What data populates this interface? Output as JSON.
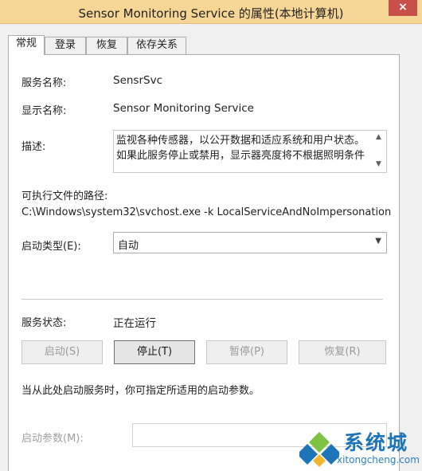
{
  "window": {
    "title": "Sensor Monitoring Service 的属性(本地计算机)",
    "close_label": "×"
  },
  "tabs": [
    {
      "label": "常规",
      "active": true
    },
    {
      "label": "登录",
      "active": false
    },
    {
      "label": "恢复",
      "active": false
    },
    {
      "label": "依存关系",
      "active": false
    }
  ],
  "general": {
    "service_name_label": "服务名称:",
    "service_name_value": "SensrSvc",
    "display_name_label": "显示名称:",
    "display_name_value": "Sensor Monitoring Service",
    "description_label": "描述:",
    "description_lines": [
      "监视各种传感器，以公开数据和适应系统和用户状态。",
      "如果此服务停止或禁用，显示器亮度将不根据照明条件"
    ],
    "path_label": "可执行文件的路径:",
    "path_value": "C:\\Windows\\system32\\svchost.exe -k LocalServiceAndNoImpersonation",
    "startup_type_label": "启动类型(E):",
    "startup_type_value": "自动",
    "status_label": "服务状态:",
    "status_value": "正在运行",
    "hint_text": "当从此处启动服务时，你可指定所适用的启动参数。",
    "param_label": "启动参数(M):",
    "param_value": ""
  },
  "buttons": {
    "start": {
      "label": "启动(S)",
      "enabled": false
    },
    "stop": {
      "label": "停止(T)",
      "enabled": true
    },
    "pause": {
      "label": "暂停(P)",
      "enabled": false
    },
    "resume": {
      "label": "恢复(R)",
      "enabled": false
    }
  },
  "watermark": {
    "brand": "系统城",
    "url": "xitongcheng.com"
  },
  "colors": {
    "titlebar": "#f6d694",
    "close_button": "#c7504a",
    "watermark_blue": "#1d75b8",
    "watermark_green": "#7dc242"
  }
}
